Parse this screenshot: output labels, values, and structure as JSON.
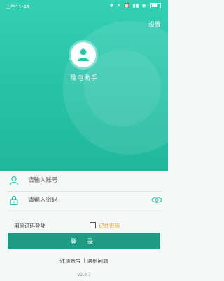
{
  "status_bar": {
    "time": "上午11:48",
    "icons": "✱ ✕ ⏰ ▮▮ ◉"
  },
  "header": {
    "settings_label": "设置"
  },
  "app": {
    "name": "豫电助手"
  },
  "form": {
    "account_placeholder": "请输入账号",
    "password_placeholder": "请输入密码",
    "sms_login_label": "用验证码登陆",
    "remember_label": "记住密码",
    "remember_checked": false,
    "login_label": "登 录"
  },
  "footer": {
    "register_label": "注册账号",
    "help_label": "遇到问题",
    "version": "V2.0.7"
  },
  "colors": {
    "primary": "#26c2a7",
    "button": "#1f9b84",
    "accent": "#e49b1e"
  },
  "icons": [
    "person-icon",
    "user-icon",
    "lock-icon",
    "eye-icon",
    "battery-icon"
  ]
}
